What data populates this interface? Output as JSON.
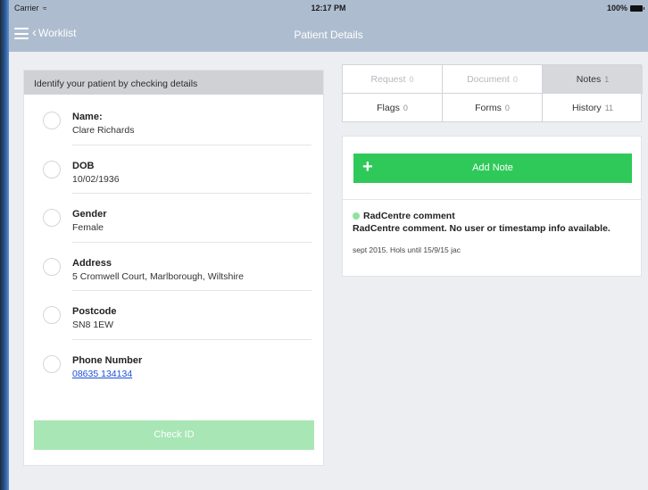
{
  "status_bar": {
    "carrier": "Carrier",
    "wifi_icon": "wifi-icon",
    "time": "12:17 PM",
    "battery": "100%"
  },
  "nav": {
    "back_label": "Worklist",
    "title": "Patient Details"
  },
  "identify": {
    "header": "Identify your patient by checking details",
    "rows": [
      {
        "label": "Name:",
        "value": "Clare Richards"
      },
      {
        "label": "DOB",
        "value": "10/02/1936"
      },
      {
        "label": "Gender",
        "value": "Female"
      },
      {
        "label": "Address",
        "value": "5 Cromwell Court, Marlborough, Wiltshire"
      },
      {
        "label": "Postcode",
        "value": "SN8 1EW"
      },
      {
        "label": "Phone Number",
        "value": "08635 134134"
      }
    ],
    "check_button": "Check ID"
  },
  "tabs": [
    {
      "label": "Request",
      "count": "0",
      "state": "disabled"
    },
    {
      "label": "Document",
      "count": "0",
      "state": "disabled"
    },
    {
      "label": "Notes",
      "count": "1",
      "state": "active"
    },
    {
      "label": "Flags",
      "count": "0",
      "state": "normal"
    },
    {
      "label": "Forms",
      "count": "0",
      "state": "normal"
    },
    {
      "label": "History",
      "count": "11",
      "state": "normal"
    }
  ],
  "notes": {
    "add_button": "Add Note",
    "items": [
      {
        "title": "RadCentre comment",
        "subtitle": "RadCentre comment. No user or timestamp info available.",
        "body": "sept 2015. Hols until 15/9/15 jac"
      }
    ]
  },
  "colors": {
    "nav_bg": "#aebccf",
    "add_note_green": "#2fc95a",
    "check_id_green": "#a8e6b5",
    "link_blue": "#1a4fd6",
    "note_dot": "#8ee39c"
  }
}
